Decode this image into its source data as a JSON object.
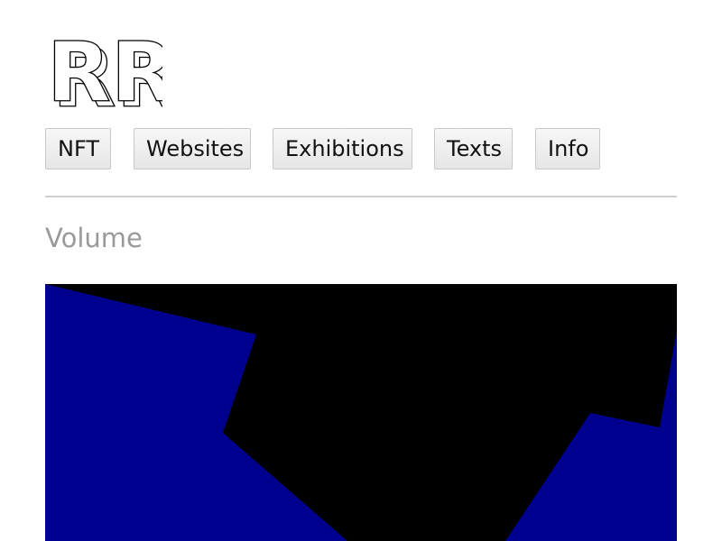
{
  "logo": {
    "text": "RR"
  },
  "nav": {
    "items": [
      {
        "label": "NFT"
      },
      {
        "label": "Websites"
      },
      {
        "label": "Exhibitions"
      },
      {
        "label": "Texts"
      },
      {
        "label": "Info"
      }
    ]
  },
  "section": {
    "title": "Volume"
  },
  "artwork": {
    "colors": {
      "background": "#000000",
      "shape": "#00008f"
    }
  }
}
